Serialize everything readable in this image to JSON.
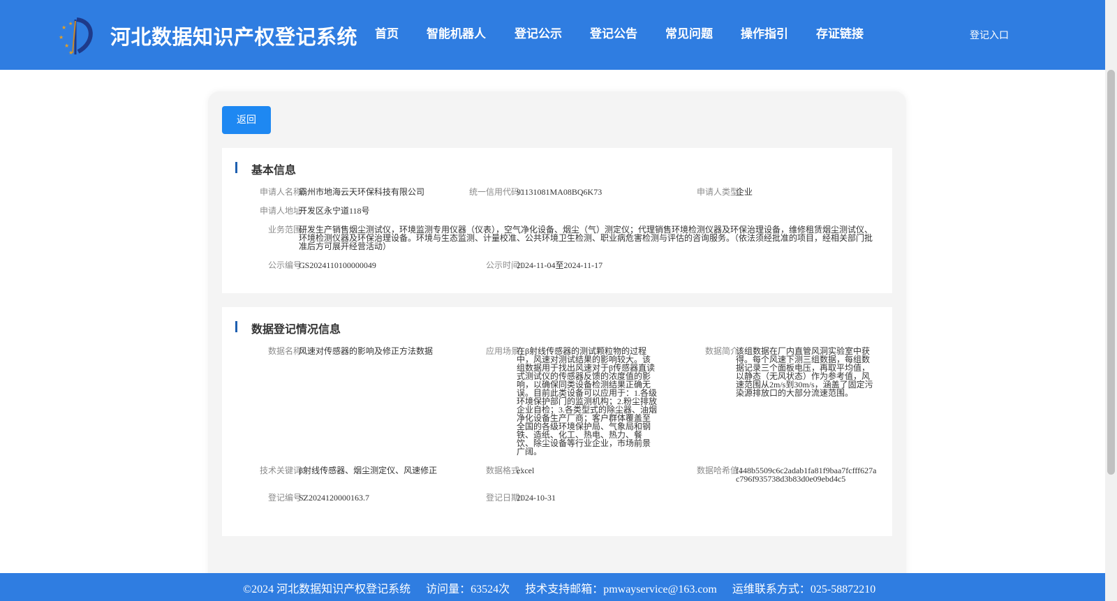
{
  "header": {
    "site_title": "河北数据知识产权登记系统",
    "nav": [
      "首页",
      "智能机器人",
      "登记公示",
      "登记公告",
      "常见问题",
      "操作指引",
      "存证链接"
    ],
    "login": "登记入口"
  },
  "back_label": "返回",
  "basic": {
    "title": "基本信息",
    "applicant_name_label": "申请人名称：",
    "applicant_name": "霸州市地海云天环保科技有限公司",
    "credit_code_label": "统一信用代码：",
    "credit_code": "91131081MA08BQ6K73",
    "applicant_type_label": "申请人类型：",
    "applicant_type": "企业",
    "address_label": "申请人地址：",
    "address": "开发区永宁道118号",
    "scope_label": "业务范围：",
    "scope": "研发生产销售烟尘测试仪，环境监测专用仪器（仪表），空气净化设备、烟尘（气）测定仪；代理销售环境检测仪器及环保治理设备，维修租赁烟尘测试仪、环境检测仪器及环保治理设备。环境与生态监测、计量校准、公共环境卫生检测、职业病危害检测与评估的咨询服务。（依法须经批准的项目，经相关部门批准后方可展开经营活动）",
    "notice_no_label": "公示编号：",
    "notice_no": "GS2024110100000049",
    "notice_time_label": "公示时间：",
    "notice_time": "2024-11-04至2024-11-17"
  },
  "registration": {
    "title": "数据登记情况信息",
    "data_name_label": "数据名称：",
    "data_name": "风速对传感器的影响及修正方法数据",
    "scenario_label": "应用场景：",
    "scenario": "在β射线传感器的测试颗粒物的过程中，风速对测试结果的影响较大。该组数据用于找出风速对于β传感器直读式测试仪的传感器反馈的浓度值的影响，以确保同类设备检测结果正确无误。目前此类设备可以应用于：1.各级环境保护部门的监测机构；2.粉尘排放企业自检；3.各类型式的除尘器、油烟净化设备生产厂商；客户群体覆盖至全国的各级环境保护局、气象局和钢铁、造纸、化工、热电、热力、餐饮、除尘设备等行业企业，市场前景广阔。",
    "summary_label": "数据简介：",
    "summary": "该组数据在厂内直管风洞实验室中获得。每个风速下测三组数据，每组数据记录三个面板电压，再取平均值，以静态（无风状态）作为参考值，风速范围从2m/s到30m/s，涵盖了固定污染源排放口的大部分流速范围。",
    "keywords_label": "技术关键词：",
    "keywords": "β射线传感器、烟尘测定仪、风速修正",
    "format_label": "数据格式：",
    "format": "excel",
    "hash_label": "数据哈希值：",
    "hash": "f448b5509c6c2adab1fa81f9baa7fcfff627ac796f935738d3b83d0e09ebd4c5",
    "reg_no_label": "登记编号：",
    "reg_no": "SZ2024120000163.7",
    "reg_date_label": "登记日期：",
    "reg_date": "2024-10-31"
  },
  "footer": {
    "copyright": "©2024 河北数据知识产权登记系统",
    "visits": "访问量：63524次",
    "email": "技术支持邮箱：pmwayservice@163.com",
    "contact": "运维联系方式：025-58872210"
  }
}
